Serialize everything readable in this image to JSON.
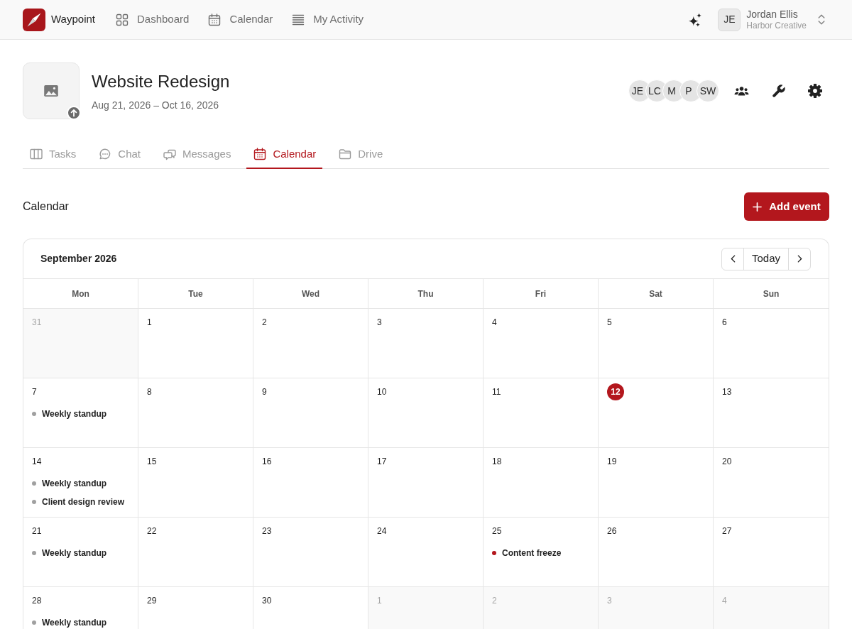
{
  "navbar": {
    "brand": "Waypoint",
    "links": [
      {
        "label": "Dashboard",
        "selected": false
      },
      {
        "label": "Calendar",
        "selected": false
      },
      {
        "label": "My Activity",
        "selected": false
      }
    ],
    "user": {
      "initials": "JE",
      "name": "Jordan Ellis",
      "organization": "Harbor Creative"
    }
  },
  "project": {
    "title": "Website Redesign",
    "dates": "Aug 21, 2026 – Oct 16, 2026",
    "members": [
      "JE",
      "LC",
      "M",
      "P",
      "SW"
    ]
  },
  "tabs": [
    {
      "label": "Tasks",
      "selected": false
    },
    {
      "label": "Chat",
      "selected": false
    },
    {
      "label": "Messages",
      "selected": false
    },
    {
      "label": "Calendar",
      "selected": true
    },
    {
      "label": "Drive",
      "selected": false
    }
  ],
  "section": {
    "title": "Calendar",
    "add_button": "Add event"
  },
  "calendar": {
    "month": "September 2026",
    "today_button": "Today",
    "weekdays": [
      "Mon",
      "Tue",
      "Wed",
      "Thu",
      "Fri",
      "Sat",
      "Sun"
    ],
    "weeks": [
      [
        {
          "day": "31",
          "outside_month": true,
          "today": false
        },
        {
          "day": "1",
          "outside_month": false,
          "today": false
        },
        {
          "day": "2",
          "outside_month": false,
          "today": false
        },
        {
          "day": "3",
          "outside_month": false,
          "today": false
        },
        {
          "day": "4",
          "outside_month": false,
          "today": false
        },
        {
          "day": "5",
          "outside_month": false,
          "today": false
        },
        {
          "day": "6",
          "outside_month": false,
          "today": false
        }
      ],
      [
        {
          "day": "7",
          "outside_month": false,
          "today": false,
          "events": [
            {
              "title": "Weekly standup",
              "color": "#a0a0a0"
            }
          ]
        },
        {
          "day": "8",
          "outside_month": false,
          "today": false
        },
        {
          "day": "9",
          "outside_month": false,
          "today": false
        },
        {
          "day": "10",
          "outside_month": false,
          "today": false
        },
        {
          "day": "11",
          "outside_month": false,
          "today": false
        },
        {
          "day": "12",
          "outside_month": false,
          "today": true
        },
        {
          "day": "13",
          "outside_month": false,
          "today": false
        }
      ],
      [
        {
          "day": "14",
          "outside_month": false,
          "today": false,
          "events": [
            {
              "title": "Weekly standup",
              "color": "#a0a0a0"
            },
            {
              "title": "Client design review",
              "color": "#a0a0a0"
            }
          ]
        },
        {
          "day": "15",
          "outside_month": false,
          "today": false
        },
        {
          "day": "16",
          "outside_month": false,
          "today": false
        },
        {
          "day": "17",
          "outside_month": false,
          "today": false
        },
        {
          "day": "18",
          "outside_month": false,
          "today": false
        },
        {
          "day": "19",
          "outside_month": false,
          "today": false
        },
        {
          "day": "20",
          "outside_month": false,
          "today": false
        }
      ],
      [
        {
          "day": "21",
          "outside_month": false,
          "today": false,
          "events": [
            {
              "title": "Weekly standup",
              "color": "#a0a0a0"
            }
          ]
        },
        {
          "day": "22",
          "outside_month": false,
          "today": false
        },
        {
          "day": "23",
          "outside_month": false,
          "today": false
        },
        {
          "day": "24",
          "outside_month": false,
          "today": false
        },
        {
          "day": "25",
          "outside_month": false,
          "today": false,
          "events": [
            {
              "title": "Content freeze",
              "color": "#b3171d"
            }
          ]
        },
        {
          "day": "26",
          "outside_month": false,
          "today": false
        },
        {
          "day": "27",
          "outside_month": false,
          "today": false
        }
      ],
      [
        {
          "day": "28",
          "outside_month": false,
          "today": false,
          "events": [
            {
              "title": "Weekly standup",
              "color": "#a0a0a0"
            }
          ]
        },
        {
          "day": "29",
          "outside_month": false,
          "today": false
        },
        {
          "day": "30",
          "outside_month": false,
          "today": false
        },
        {
          "day": "1",
          "outside_month": true,
          "today": false
        },
        {
          "day": "2",
          "outside_month": true,
          "today": false
        },
        {
          "day": "3",
          "outside_month": true,
          "today": false
        },
        {
          "day": "4",
          "outside_month": true,
          "today": false
        }
      ]
    ]
  }
}
